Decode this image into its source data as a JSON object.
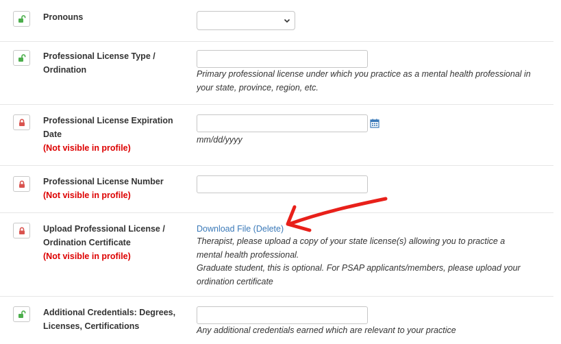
{
  "fields": [
    {
      "label": "Pronouns",
      "lock": "unlocked",
      "lock_color": "#4cae4c",
      "control": "select",
      "selected": ""
    },
    {
      "label": "Professional License Type / Ordination",
      "lock": "unlocked",
      "lock_color": "#4cae4c",
      "control": "text",
      "value": "",
      "help": "Primary professional license under which you practice as a mental health professional in your state, province, region, etc."
    },
    {
      "label": "Professional License Expiration Date",
      "private_note": "(Not visible in profile)",
      "lock": "locked",
      "lock_color": "#d9534f",
      "control": "date",
      "value": "",
      "help": "mm/dd/yyyy",
      "icon": "calendar-icon"
    },
    {
      "label": "Professional License Number",
      "private_note": "(Not visible in profile)",
      "lock": "locked",
      "lock_color": "#d9534f",
      "control": "text",
      "value": ""
    },
    {
      "label": "Upload Professional License / Ordination Certificate",
      "private_note": "(Not visible in profile)",
      "lock": "locked",
      "lock_color": "#d9534f",
      "control": "file",
      "link_text": "Download File (Delete)",
      "help_lines": [
        "Therapist, please upload a copy of your state license(s) allowing you to practice a mental health professional.",
        "Graduate student, this is optional. For PSAP applicants/members, please upload your ordination certificate"
      ]
    },
    {
      "label": "Additional Credentials: Degrees, Licenses, Certifications",
      "lock": "unlocked",
      "lock_color": "#4cae4c",
      "control": "text",
      "value": "",
      "help": "Any additional credentials earned which are relevant to your practice"
    }
  ],
  "annotation": {
    "type": "red-arrow",
    "color": "#e8201a",
    "points_to": "Download File (Delete)"
  },
  "colors": {
    "link": "#3a79b8",
    "private": "#dd0000",
    "calendar": "#3a79b8"
  }
}
